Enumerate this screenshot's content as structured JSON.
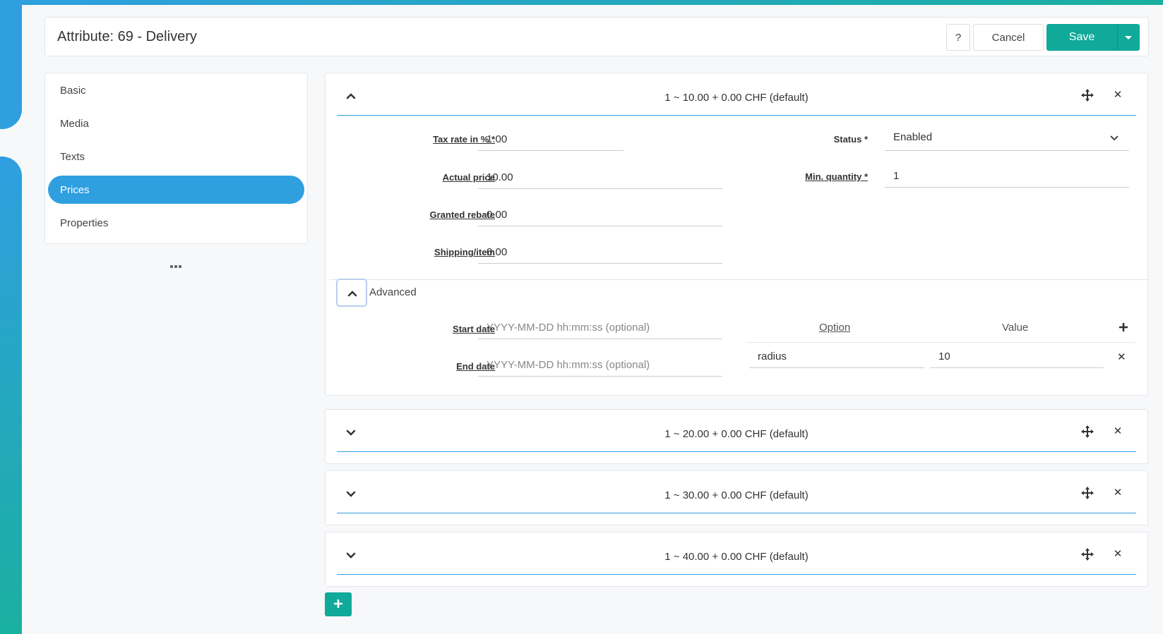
{
  "header": {
    "title": "Attribute: 69 - Delivery",
    "help_label": "?",
    "cancel_label": "Cancel",
    "save_label": "Save"
  },
  "nav": {
    "items": [
      {
        "label": "Basic",
        "active": false
      },
      {
        "label": "Media",
        "active": false
      },
      {
        "label": "Texts",
        "active": false
      },
      {
        "label": "Prices",
        "active": true
      },
      {
        "label": "Properties",
        "active": false
      }
    ],
    "more_label": "..."
  },
  "prices": [
    {
      "summary": "1 ~ 10.00 + 0.00 CHF (default)",
      "expanded": true,
      "fields": {
        "tax_rate_label": "Tax rate in %",
        "tax_rate_required": "*",
        "tax_rate_value": "1.00",
        "actual_price_label": "Actual price",
        "actual_price_value": "10.00",
        "granted_rebate_label": "Granted rebate",
        "granted_rebate_value": "0.00",
        "shipping_label": "Shipping/item",
        "shipping_value": "0.00",
        "status_label": "Status",
        "status_required": "*",
        "status_value": "Enabled",
        "min_quantity_label": "Min. quantity",
        "min_quantity_required": "*",
        "min_quantity_value": "1"
      },
      "advanced": {
        "label": "Advanced",
        "start_date_label": "Start date",
        "start_date_placeholder": "YYYY-MM-DD hh:mm:ss (optional)",
        "end_date_label": "End date",
        "end_date_placeholder": "YYYY-MM-DD hh:mm:ss (optional)",
        "option_header": "Option",
        "value_header": "Value",
        "options": [
          {
            "option": "radius",
            "value": "10"
          }
        ]
      }
    },
    {
      "summary": "1 ~ 20.00 + 0.00 CHF (default)",
      "expanded": false
    },
    {
      "summary": "1 ~ 30.00 + 0.00 CHF (default)",
      "expanded": false
    },
    {
      "summary": "1 ~ 40.00 + 0.00 CHF (default)",
      "expanded": false
    }
  ],
  "icons": {
    "expand": "chevron-up-icon",
    "collapse": "chevron-down-icon",
    "move": "move-icon",
    "delete": "close-icon",
    "add": "plus-icon"
  },
  "colors": {
    "primary": "#2f9fe0",
    "success": "#10a99a"
  }
}
